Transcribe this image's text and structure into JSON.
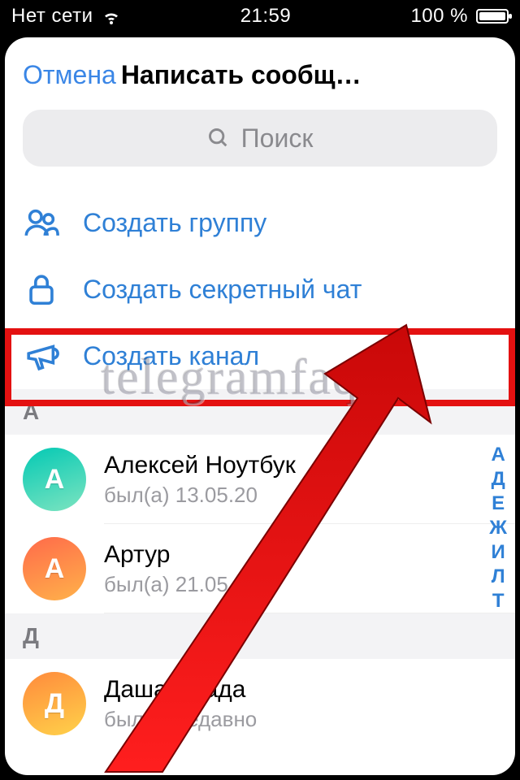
{
  "statusbar": {
    "network": "Нет сети",
    "time": "21:59",
    "battery": "100 %"
  },
  "header": {
    "cancel": "Отмена",
    "title": "Написать сообщ…"
  },
  "search": {
    "placeholder": "Поиск"
  },
  "options": {
    "group": "Создать группу",
    "secret": "Создать секретный чат",
    "channel": "Создать канал"
  },
  "sections": {
    "a": "А",
    "d": "Д"
  },
  "contacts": [
    {
      "initial": "А",
      "name": "Алексей Ноутбук",
      "sub": "был(а) 13.05.20"
    },
    {
      "initial": "А",
      "name": "Артур",
      "sub": "был(а) 21.05.20"
    },
    {
      "initial": "Д",
      "name": "Даша Влада",
      "sub": "был(а) недавно"
    }
  ],
  "index": [
    "А",
    "Д",
    "Е",
    "Ж",
    "И",
    "Л",
    "Т"
  ],
  "watermark": "telegramfaq.ru"
}
